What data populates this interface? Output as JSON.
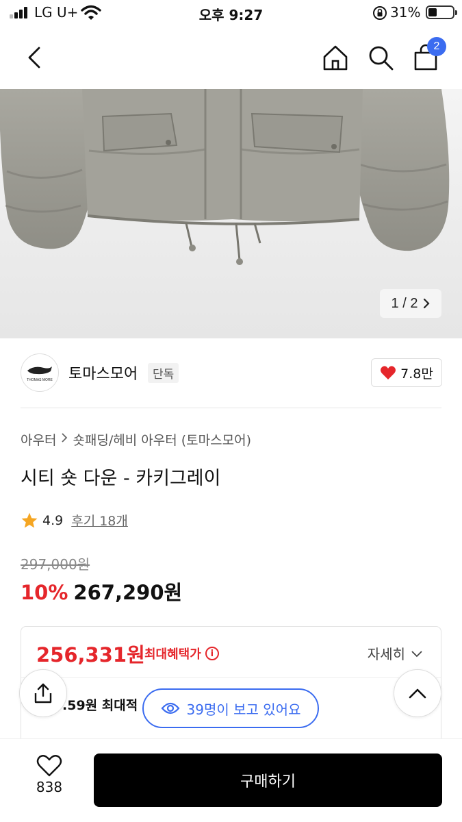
{
  "status_bar": {
    "carrier": "LG U+",
    "time": "오후 9:27",
    "battery": "31%"
  },
  "nav": {
    "cart_count": "2"
  },
  "hero": {
    "pager_text": "1 / 2"
  },
  "store": {
    "logo_text": "THOMAS MORE",
    "name": "토마스모어",
    "exclusive_badge": "단독",
    "likes": "7.8만"
  },
  "breadcrumb": [
    "아우터",
    "숏패딩/헤비 아우터 (토마스모어)"
  ],
  "product": {
    "title": "시티 숏 다운 - 카키그레이",
    "rating": "4.9",
    "reviews": "후기 18개",
    "original_price": "297,000원",
    "discount": "10%",
    "price": "267,290원"
  },
  "benefit": {
    "max_price": "256,331원",
    "max_label": "최대혜택가",
    "info_icon": "i",
    "detail": "자세히",
    "points_partial": ".59원 최대적"
  },
  "viewers": "39명이 보고 있어요",
  "bottom": {
    "wish_count": "838",
    "buy_label": "구매하기"
  },
  "colors": {
    "accent_blue": "#3b6cf0",
    "sale_red": "#e5262b",
    "heart_red": "#e5262b",
    "buy_black": "#000000"
  }
}
